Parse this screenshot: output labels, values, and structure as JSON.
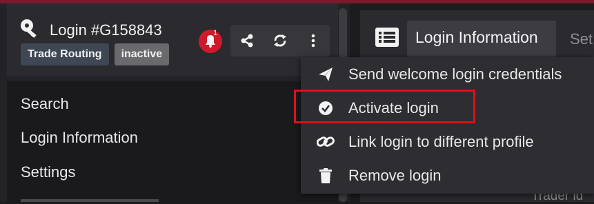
{
  "header": {
    "title": "Login #G158843",
    "badges": [
      "Trade Routing",
      "inactive"
    ],
    "notification_count": "1",
    "icons": [
      "key-icon",
      "bell-icon",
      "share-icon",
      "refresh-icon",
      "more-vertical-icon"
    ]
  },
  "nav": {
    "items": [
      {
        "label": "Search"
      },
      {
        "label": "Login Information"
      },
      {
        "label": "Settings"
      }
    ]
  },
  "tabs": {
    "active_label": "Login Information",
    "next_label_partial": "Set"
  },
  "menu": {
    "items": [
      {
        "label": "Send welcome login credentials",
        "icon": "paper-plane-icon"
      },
      {
        "label": "Activate login",
        "icon": "check-circle-icon"
      },
      {
        "label": "Link login to different profile",
        "icon": "link-icon"
      },
      {
        "label": "Remove login",
        "icon": "trash-icon"
      }
    ],
    "highlighted_item": "Activate login",
    "highlight_color": "#e01018"
  },
  "background_text": "Trader id",
  "colors": {
    "accent_red": "#d0192b",
    "top_border": "#7a1a2c"
  }
}
